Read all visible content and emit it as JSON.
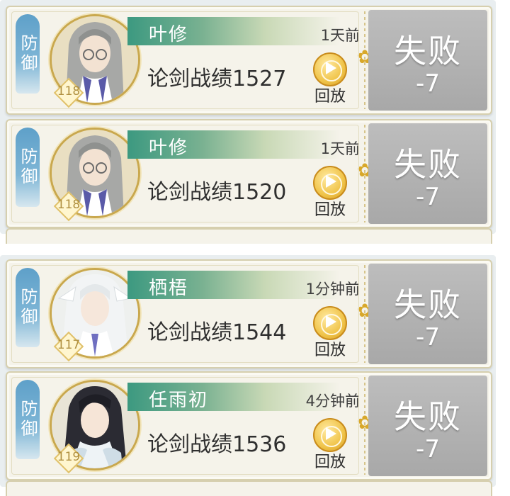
{
  "colors": {
    "accent_teal": "#3c9980",
    "gold": "#f0c44a",
    "defense_tag": "#5ea0c9",
    "result_gray": "#a8a8a8"
  },
  "records": [
    {
      "tag": "防御",
      "name": "叶修",
      "level": "118",
      "time": "1天前",
      "record_label": "论剑战绩1527",
      "replay": "回放",
      "result": "失败",
      "score": "-7",
      "avatar_icon": "avatar-silver-hair-glasses"
    },
    {
      "tag": "防御",
      "name": "叶修",
      "level": "118",
      "time": "1天前",
      "record_label": "论剑战绩1520",
      "replay": "回放",
      "result": "失败",
      "score": "-7",
      "avatar_icon": "avatar-silver-hair-glasses"
    },
    {
      "tag": "防御",
      "name": "栖梧",
      "level": "117",
      "time": "1分钟前",
      "record_label": "论剑战绩1544",
      "replay": "回放",
      "result": "失败",
      "score": "-7",
      "avatar_icon": "avatar-white-hair"
    },
    {
      "tag": "防御",
      "name": "任雨初",
      "level": "119",
      "time": "4分钟前",
      "record_label": "论剑战绩1536",
      "replay": "回放",
      "result": "失败",
      "score": "-7",
      "avatar_icon": "avatar-black-hair"
    }
  ]
}
